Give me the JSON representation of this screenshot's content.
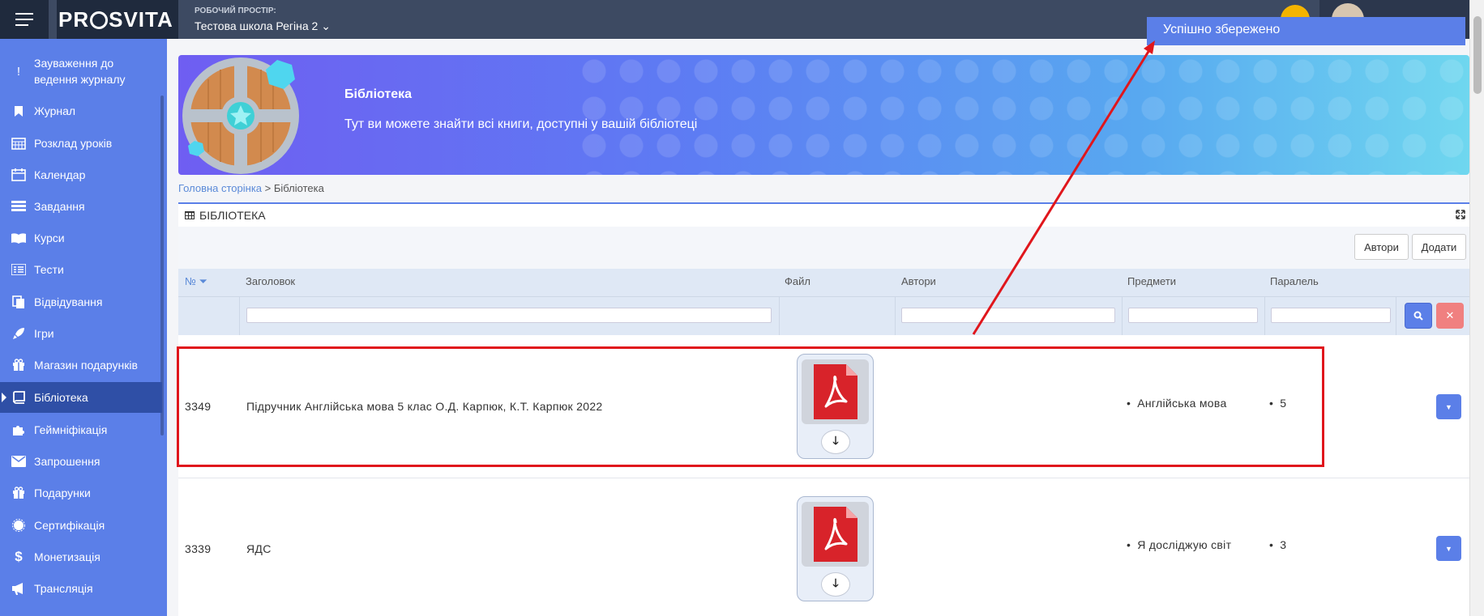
{
  "topbar": {
    "logo": "PROSVITA",
    "workspace_label": "РОБОЧИЙ ПРОСТІР:",
    "workspace_value": "Тестова школа Регіна 2 ⌄"
  },
  "toast": {
    "message": "Успішно збережено"
  },
  "sidebar": {
    "items": [
      {
        "label": "Зауваження до ведення журналу",
        "icon": "exclamation-icon"
      },
      {
        "label": "Журнал",
        "icon": "bookmark-icon"
      },
      {
        "label": "Розклад уроків",
        "icon": "calendar-grid-icon"
      },
      {
        "label": "Календар",
        "icon": "calendar-icon"
      },
      {
        "label": "Завдання",
        "icon": "tasks-icon"
      },
      {
        "label": "Курси",
        "icon": "book-open-icon"
      },
      {
        "label": "Тести",
        "icon": "list-icon"
      },
      {
        "label": "Відвідування",
        "icon": "copy-icon"
      },
      {
        "label": "Ігри",
        "icon": "rocket-icon"
      },
      {
        "label": "Магазин подарунків",
        "icon": "gift-icon"
      },
      {
        "label": "Бібліотека",
        "icon": "book-icon",
        "active": true
      },
      {
        "label": "Геймніфікація",
        "icon": "puzzle-icon"
      },
      {
        "label": "Запрошення",
        "icon": "envelope-icon"
      },
      {
        "label": "Подарунки",
        "icon": "gift-icon"
      },
      {
        "label": "Сертифікація",
        "icon": "badge-icon"
      },
      {
        "label": "Монетизація",
        "icon": "dollar-icon"
      },
      {
        "label": "Трансляція",
        "icon": "bullhorn-icon"
      }
    ]
  },
  "banner": {
    "title": "Бібліотека",
    "subtitle": "Тут ви можете знайти всі книги, доступні у вашій бібліотеці"
  },
  "breadcrumb": {
    "home": "Головна сторінка",
    "separator": " > ",
    "current": "Бібліотека"
  },
  "panel": {
    "title": "БІБЛІОТЕКА",
    "buttons": {
      "authors": "Автори",
      "add": "Додати"
    }
  },
  "table": {
    "columns": [
      "№ ⏷",
      "Заголовок",
      "Файл",
      "Автори",
      "Предмети",
      "Паралель"
    ],
    "rows": [
      {
        "id": "3349",
        "title": "Підручник Англійська мова 5 клас О.Д. Карпюк, К.Т. Карпюк 2022",
        "authors": "",
        "subject": "Англійська мова",
        "parallel": "5"
      },
      {
        "id": "3339",
        "title": "ЯДС",
        "authors": "",
        "subject": "Я досліджую світ",
        "parallel": "3"
      }
    ]
  },
  "colors": {
    "accent": "#5b7fe8",
    "topbar": "#3d4a62",
    "highlight": "#e0161c"
  }
}
